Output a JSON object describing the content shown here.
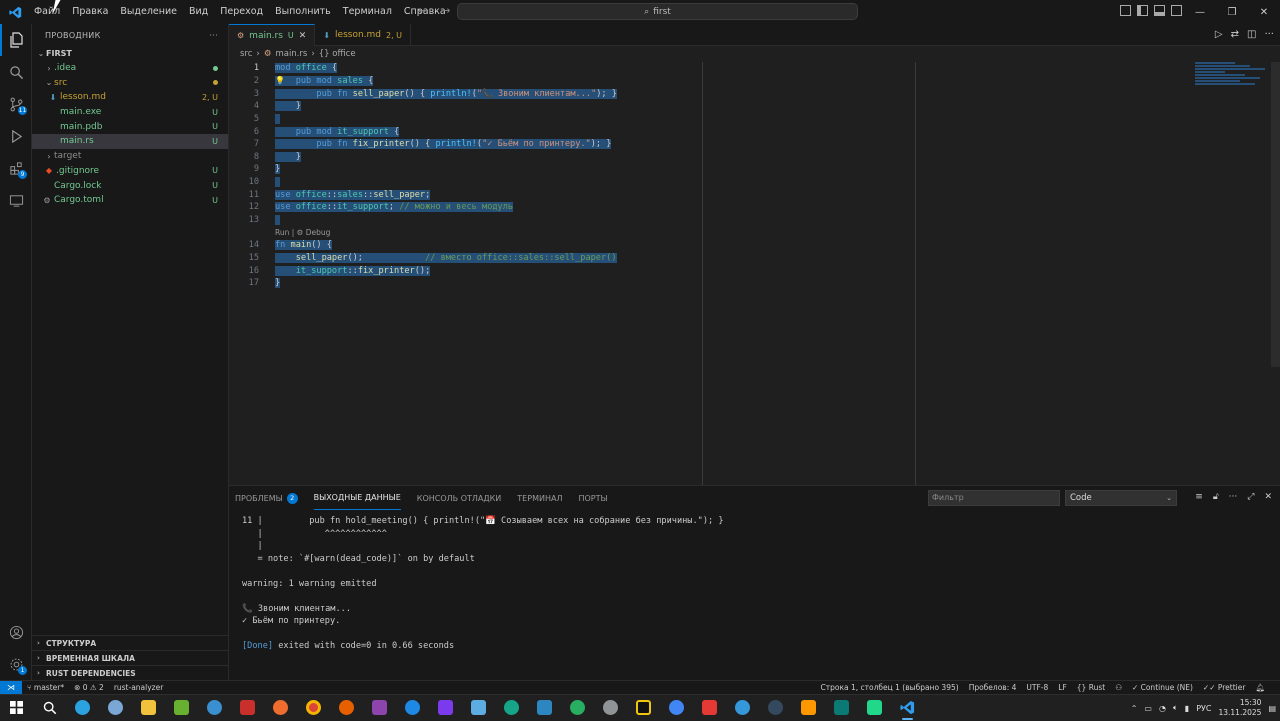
{
  "titlebar": {
    "menu": [
      "Файл",
      "Правка",
      "Выделение",
      "Вид",
      "Переход",
      "Выполнить",
      "Терминал",
      "Справка"
    ],
    "search": "first"
  },
  "sidebar": {
    "title": "ПРОВОДНИК",
    "root": "FIRST",
    "items": [
      {
        "label": ".idea",
        "status": "",
        "color": "#73c991",
        "dot": "#73c991"
      },
      {
        "label": "src",
        "status": "",
        "color": "#c5a332",
        "dot": "#c5a332"
      },
      {
        "label": "lesson.md",
        "status": "2, U",
        "color": "#c5a332"
      },
      {
        "label": "main.exe",
        "status": "U",
        "color": "#73c991"
      },
      {
        "label": "main.pdb",
        "status": "U",
        "color": "#73c991"
      },
      {
        "label": "main.rs",
        "status": "U",
        "color": "#73c991"
      },
      {
        "label": "target",
        "status": "",
        "color": "#8c8c8c"
      },
      {
        "label": ".gitignore",
        "status": "U",
        "color": "#73c991"
      },
      {
        "label": "Cargo.lock",
        "status": "U",
        "color": "#73c991"
      },
      {
        "label": "Cargo.toml",
        "status": "U",
        "color": "#73c991"
      }
    ],
    "sections": [
      "СТРУКТУРА",
      "ВРЕМЕННАЯ ШКАЛА",
      "RUST DEPENDENCIES"
    ]
  },
  "tabs": [
    {
      "label": "main.rs",
      "mod": "U",
      "active": true
    },
    {
      "label": "lesson.md",
      "mod": "2, U",
      "active": false
    }
  ],
  "breadcrumbs": {
    "a": "src",
    "b": "main.rs",
    "c": "{} office"
  },
  "code": {
    "lines": [
      {
        "n": "1",
        "html": "<span class='sel-bg'><span class='kw'>mod</span> <span class='md'>office</span> {</span>"
      },
      {
        "n": "2",
        "html": "<span class='sel-bg'>    <span class='kw'>pub</span> <span class='kw'>mod</span> <span class='md'>sales</span> {</span>"
      },
      {
        "n": "3",
        "html": "<span class='sel-bg'>        <span class='kw'>pub</span> <span class='kw'>fn</span> <span class='fn'>sell_paper</span>() { <span class='mac'>println!</span>(<span class='st2'>\"📞 Звоним клиентам...\"</span>); }</span>"
      },
      {
        "n": "4",
        "html": "<span class='sel-bg'>    }</span>"
      },
      {
        "n": "5",
        "html": "<span class='sel-bg'> </span>"
      },
      {
        "n": "6",
        "html": "<span class='sel-bg'>    <span class='kw'>pub</span> <span class='kw'>mod</span> <span class='md'>it_support</span> {</span>"
      },
      {
        "n": "7",
        "html": "<span class='sel-bg'>        <span class='kw'>pub</span> <span class='kw'>fn</span> <span class='fn'>fix_printer</span>() { <span class='mac'>println!</span>(<span class='st2'>\"✓ Бьём по принтеру.\"</span>); }</span>"
      },
      {
        "n": "8",
        "html": "<span class='sel-bg'>    }</span>"
      },
      {
        "n": "9",
        "html": "<span class='sel-bg'>}</span>"
      },
      {
        "n": "10",
        "html": "<span class='sel-bg'> </span>"
      },
      {
        "n": "11",
        "html": "<span class='sel-bg'><span class='kw'>use</span> <span class='md'>office</span>::<span class='md'>sales</span>::<span class='fn'>sell_paper</span>;</span>"
      },
      {
        "n": "12",
        "html": "<span class='sel-bg'><span class='kw'>use</span> <span class='md'>office</span>::<span class='md'>it_support</span>; <span class='cm'>// можно и весь модуль</span></span>"
      },
      {
        "n": "13",
        "html": "<span class='sel-bg'> </span>"
      },
      {
        "n": "14",
        "html": "<span class='sel-bg'><span class='kw'>fn</span> <span class='fn'>main</span>() {</span>"
      },
      {
        "n": "15",
        "html": "<span class='sel-bg'>    <span class='fn'>sell_paper</span>();            <span class='cm'>// вместо office::sales::sell_paper()</span></span>"
      },
      {
        "n": "16",
        "html": "<span class='sel-bg'>    <span class='md'>it_support</span>::<span class='fn'>fix_printer</span>();</span>"
      },
      {
        "n": "17",
        "html": "<span class='sel-bg'>}</span>"
      }
    ],
    "codelens": "Run | ⚙ Debug"
  },
  "panel": {
    "tabs": [
      {
        "label": "ПРОБЛЕМЫ",
        "badge": "2"
      },
      {
        "label": "ВЫХОДНЫЕ ДАННЫЕ",
        "badge": ""
      },
      {
        "label": "КОНСОЛЬ ОТЛАДКИ",
        "badge": ""
      },
      {
        "label": "ТЕРМИНАЛ",
        "badge": ""
      },
      {
        "label": "ПОРТЫ",
        "badge": ""
      }
    ],
    "filter_placeholder": "Фильтр",
    "channel": "Code",
    "output": [
      "11 |         pub fn hold_meeting() { println!(\"📅 Созываем всех на собрание без причины.\"); }",
      "   |            ^^^^^^^^^^^^",
      "   |",
      "   = note: `#[warn(dead_code)]` on by default",
      "",
      "warning: 1 warning emitted",
      "",
      "📞 Звоним клиентам...",
      "✓ Бьём по принтеру.",
      "",
      "[Done] exited with code=0 in 0.66 seconds"
    ]
  },
  "statusbar": {
    "branch": "master*",
    "problems": "⊗ 0 ⚠ 2",
    "analyzer": "rust-analyzer",
    "position": "Строка 1, столбец 1 (выбрано 395)",
    "spaces": "Пробелов: 4",
    "encoding": "UTF-8",
    "eol": "LF",
    "language": "Rust",
    "continue": "Continue (NE)",
    "prettier": "Prettier"
  },
  "taskbar": {
    "lang": "РУС",
    "time": "15:30",
    "date": "13.11.2025"
  }
}
